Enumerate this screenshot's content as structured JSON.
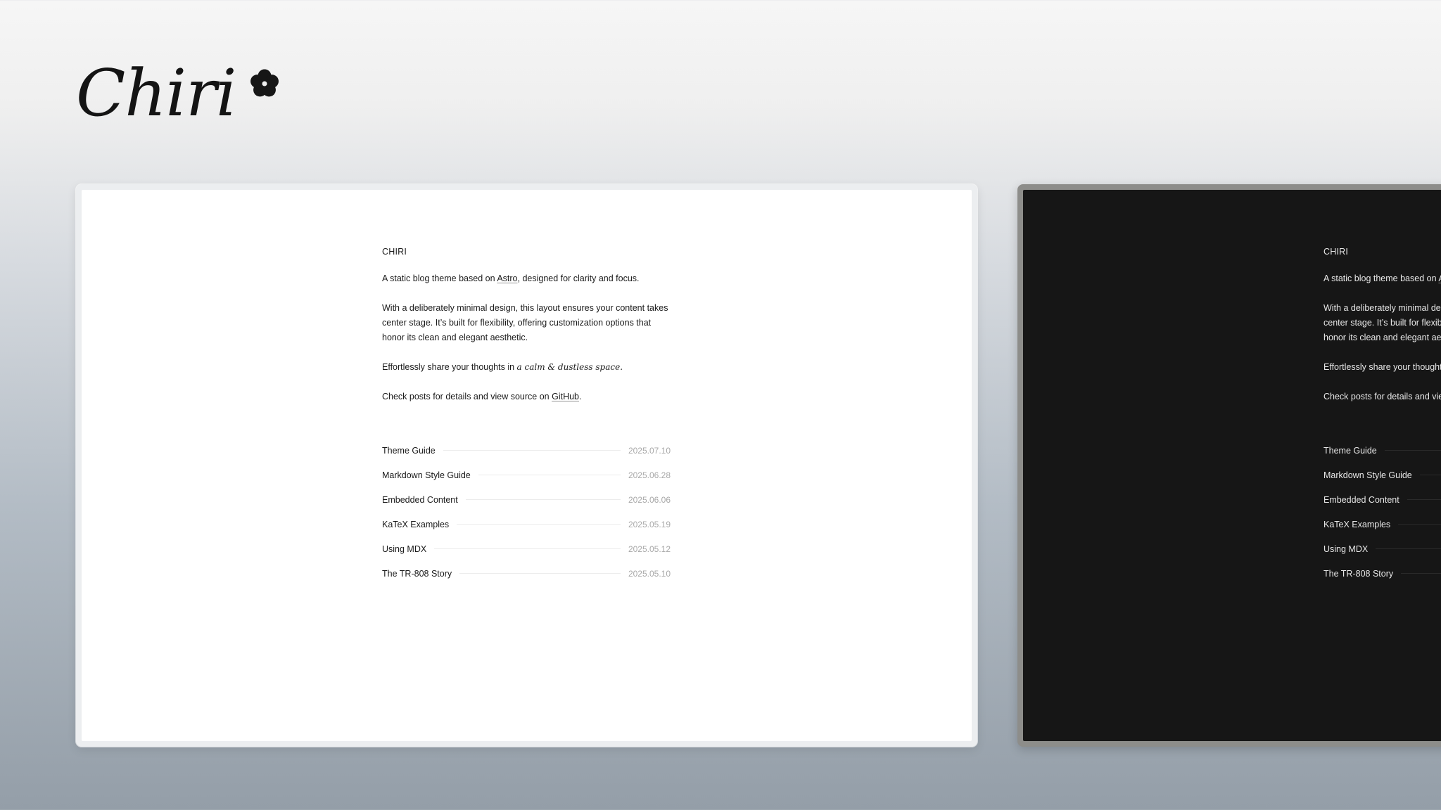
{
  "brand": {
    "name": "Chiri",
    "icon": "flower-icon"
  },
  "site": {
    "title": "CHIRI",
    "intro_prefix": "A static blog theme based on ",
    "intro_link": "Astro",
    "intro_suffix": ", designed for clarity and focus.",
    "body_lines": [
      "With a deliberately minimal design, this layout ensures your content takes",
      "center stage. It’s built for flexibility, offering customization options that",
      "honor its clean and elegant aesthetic."
    ],
    "share_prefix": "Effortlessly share your thoughts in ",
    "share_emphasis": "a calm & dustless space.",
    "source_prefix": "Check posts for details and view source on ",
    "source_link": "GitHub",
    "source_suffix": "."
  },
  "posts": [
    {
      "title": "Theme Guide",
      "date": "2025.07.10"
    },
    {
      "title": "Markdown Style Guide",
      "date": "2025.06.28"
    },
    {
      "title": "Embedded Content",
      "date": "2025.06.06"
    },
    {
      "title": "KaTeX Examples",
      "date": "2025.05.19"
    },
    {
      "title": "Using MDX",
      "date": "2025.05.12"
    },
    {
      "title": "The TR-808 Story",
      "date": "2025.05.10"
    }
  ],
  "themes": {
    "light_background": "#ffffff",
    "dark_background": "#161616",
    "light_text": "#1a1a1a",
    "dark_text": "#e8e8e8"
  }
}
